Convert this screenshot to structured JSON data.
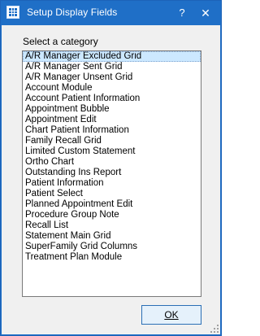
{
  "window": {
    "title": "Setup Display Fields",
    "help_glyph": "?",
    "close_glyph": "✕",
    "title_bar_color": "#1f6fc7"
  },
  "category": {
    "label": "Select a category",
    "selected_index": 0,
    "items": [
      "A/R Manager Excluded Grid",
      "A/R Manager Sent Grid",
      "A/R Manager Unsent Grid",
      "Account Module",
      "Account Patient Information",
      "Appointment Bubble",
      "Appointment Edit",
      "Chart Patient Information",
      "Family Recall Grid",
      "Limited Custom Statement",
      "Ortho Chart",
      "Outstanding Ins Report",
      "Patient Information",
      "Patient Select",
      "Planned Appointment Edit",
      "Procedure Group Note",
      "Recall List",
      "Statement Main Grid",
      "SuperFamily Grid Columns",
      "Treatment Plan Module"
    ]
  },
  "buttons": {
    "ok_label": "OK"
  }
}
